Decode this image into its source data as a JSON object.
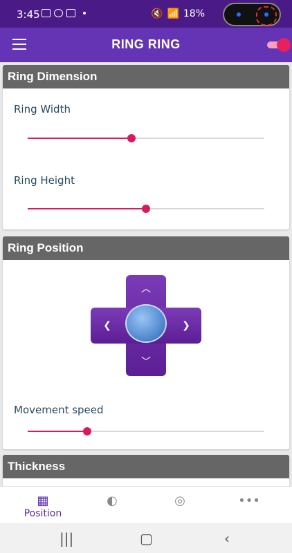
{
  "status_bar": {
    "time": "3:45",
    "battery": "18%"
  },
  "app_bar": {
    "title": "RING RING"
  },
  "sections": {
    "ring_dimension": {
      "title": "Ring Dimension",
      "width_label": "Ring Width",
      "width_value": 0.44,
      "height_label": "Ring Height",
      "height_value": 0.5
    },
    "ring_position": {
      "title": "Ring Position",
      "speed_label": "Movement speed",
      "speed_value": 0.25
    },
    "thickness": {
      "title": "Thickness"
    }
  },
  "bottom_nav": {
    "items": [
      {
        "label": "Position",
        "icon": "grid-icon"
      },
      {
        "label": "",
        "icon": "palette-icon"
      },
      {
        "label": "",
        "icon": "rings-icon"
      },
      {
        "label": "",
        "icon": "more-icon"
      }
    ]
  },
  "colors": {
    "primary": "#6434b4",
    "status": "#4a1a86",
    "accent": "#d81b60",
    "header": "#666666"
  }
}
